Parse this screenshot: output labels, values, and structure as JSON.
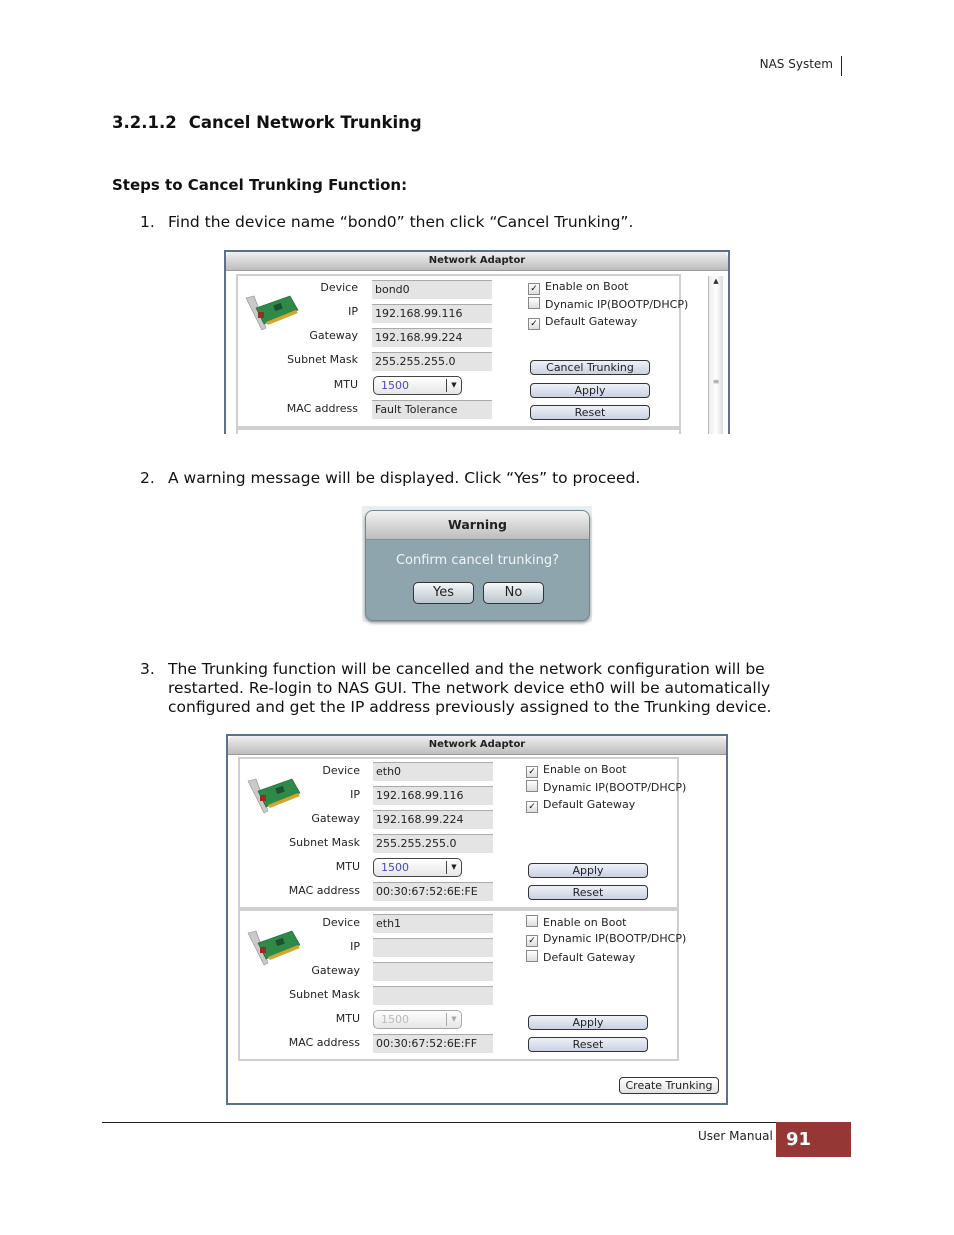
{
  "header": {
    "product": "NAS System"
  },
  "section": {
    "number": "3.2.1.2",
    "title": "Cancel Network Trunking"
  },
  "steps_title": "Steps to Cancel Trunking Function:",
  "steps": [
    {
      "num": "1.",
      "text": "Find the device name “bond0” then click “Cancel Trunking”."
    },
    {
      "num": "2.",
      "text": "A warning message will be displayed. Click “Yes” to proceed."
    },
    {
      "num": "3.",
      "text": "The Trunking function will be cancelled and the network configuration will be restarted. Re-login to NAS GUI. The network device eth0 will be automatically configured and get the IP address previously assigned to the Trunking device."
    }
  ],
  "labels": {
    "device": "Device",
    "ip": "IP",
    "gateway": "Gateway",
    "subnet": "Subnet Mask",
    "mtu": "MTU",
    "mac": "MAC address",
    "enable_boot": "Enable on Boot",
    "dynamic_ip": "Dynamic IP(BOOTP/DHCP)",
    "default_gw": "Default Gateway",
    "apply": "Apply",
    "reset": "Reset",
    "cancel_trunking": "Cancel Trunking",
    "create_trunking": "Create Trunking"
  },
  "screenshot1": {
    "title": "Network Adaptor",
    "adapter": {
      "device": "bond0",
      "ip": "192.168.99.116",
      "gateway": "192.168.99.224",
      "subnet": "255.255.255.0",
      "mtu": "1500",
      "mac": "Fault Tolerance",
      "enable_boot": true,
      "dynamic_ip": false,
      "default_gw": true
    }
  },
  "warning": {
    "title": "Warning",
    "message": "Confirm cancel trunking?",
    "yes": "Yes",
    "no": "No"
  },
  "screenshot2": {
    "title": "Network Adaptor",
    "adapters": [
      {
        "device": "eth0",
        "ip": "192.168.99.116",
        "gateway": "192.168.99.224",
        "subnet": "255.255.255.0",
        "mtu": "1500",
        "mac": "00:30:67:52:6E:FE",
        "enable_boot": true,
        "dynamic_ip": false,
        "default_gw": true
      },
      {
        "device": "eth1",
        "ip": "",
        "gateway": "",
        "subnet": "",
        "mtu": "1500",
        "mac": "00:30:67:52:6E:FF",
        "enable_boot": false,
        "dynamic_ip": true,
        "default_gw": false
      }
    ]
  },
  "footer": {
    "label": "User Manual",
    "page": "91"
  }
}
